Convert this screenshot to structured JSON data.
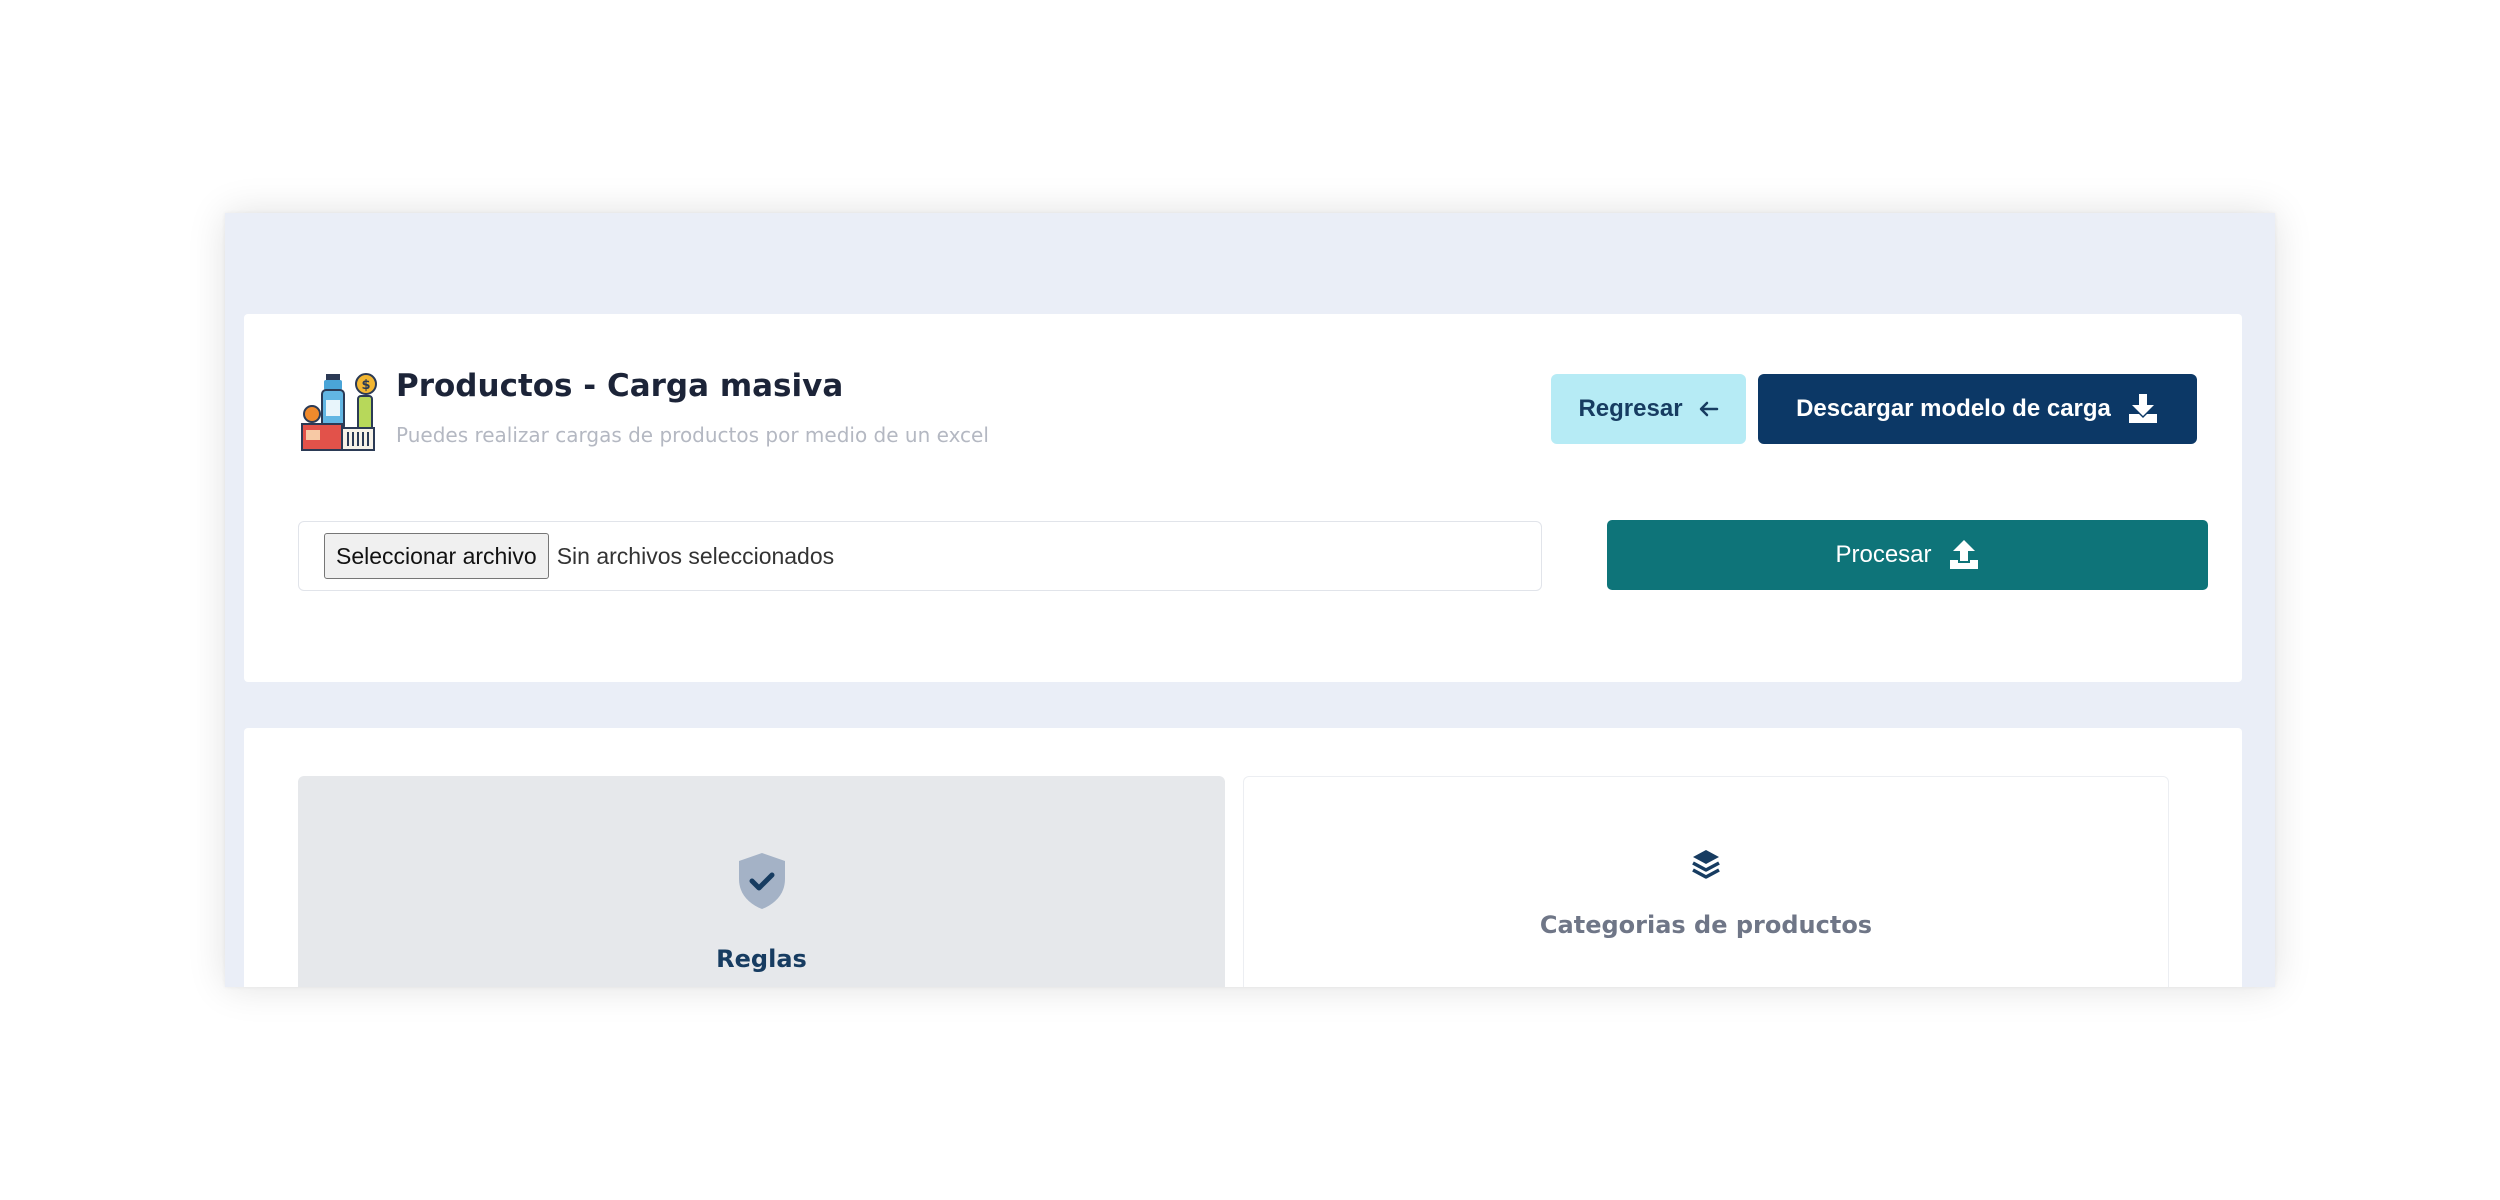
{
  "header": {
    "title": "Productos - Carga masiva",
    "subtitle": "Puedes realizar cargas de productos por medio de un excel",
    "icon": "products-icon"
  },
  "actions": {
    "back_label": "Regresar",
    "back_icon": "arrow-left-icon",
    "download_label": "Descargar modelo de carga",
    "download_icon": "download-icon"
  },
  "upload": {
    "choose_label": "Seleccionar archivo",
    "status_text": "Sin archivos seleccionados",
    "process_label": "Procesar",
    "process_icon": "upload-icon"
  },
  "tabs": [
    {
      "label": "Reglas",
      "icon": "shield-check-icon",
      "active": true
    },
    {
      "label": "Categorias de productos",
      "icon": "layers-icon",
      "active": false
    }
  ],
  "colors": {
    "background": "#eaeef7",
    "back_button": "#b6ebf5",
    "download_button": "#0c3866",
    "process_button": "#0e7479",
    "active_tab": "#e6e8eb"
  }
}
